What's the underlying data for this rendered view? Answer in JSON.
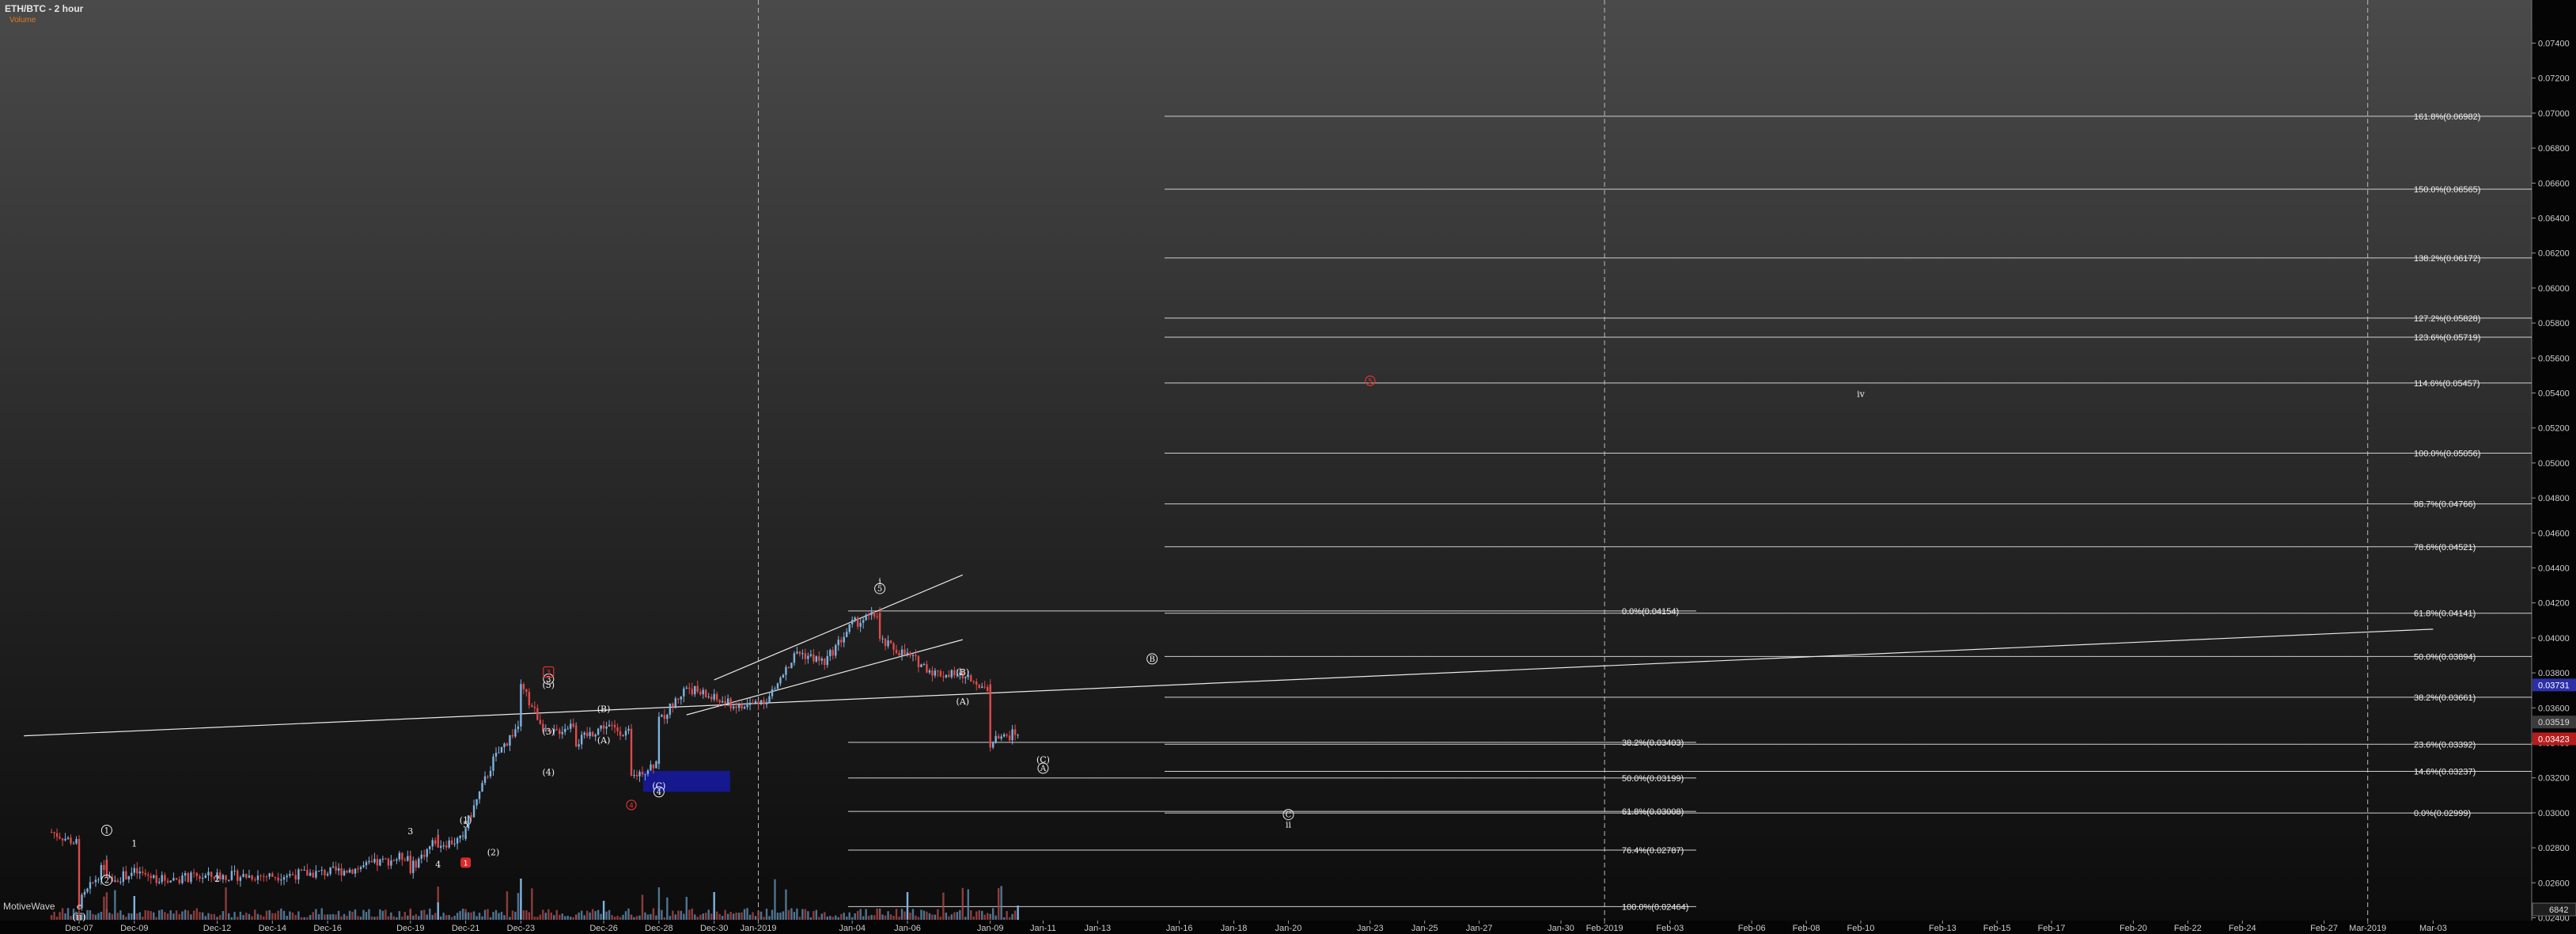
{
  "header": {
    "title": "ETH/BTC - 2 hour",
    "volume_label": "Volume"
  },
  "brand": "MotiveWave",
  "colors": {
    "up": "#7fb2de",
    "down": "#e04a4a",
    "axis_text": "#cccccc",
    "price_current": "#2c2fa5",
    "price_last": "#b71c1c",
    "box": "#16189a",
    "grid": "#d0d0d0"
  },
  "chart_data": {
    "type": "candlestick",
    "title": "ETH/BTC - 2 hour",
    "xlabel": "",
    "ylabel": "",
    "ylim": [
      0.0228,
      0.0742
    ],
    "x_ticks": [
      "Dec-07",
      "Dec-09",
      "Dec-12",
      "Dec-14",
      "Dec-16",
      "Dec-19",
      "Dec-21",
      "Dec-23",
      "Dec-26",
      "Dec-28",
      "Dec-30",
      "Jan-2019",
      "Jan-04",
      "Jan-06",
      "Jan-09",
      "Jan-11",
      "Jan-13",
      "Jan-16",
      "Jan-18",
      "Jan-20",
      "Jan-23",
      "Jan-25",
      "Jan-27",
      "Jan-30",
      "Feb-2019",
      "Feb-03",
      "Feb-06",
      "Feb-08",
      "Feb-10",
      "Feb-13",
      "Feb-15",
      "Feb-17",
      "Feb-20",
      "Feb-22",
      "Feb-24",
      "Feb-27",
      "Mar-2019",
      "Mar-03"
    ],
    "y_ticks": [
      "0.02400",
      "0.02600",
      "0.02800",
      "0.03000",
      "0.03200",
      "0.03400",
      "0.03600",
      "0.03800",
      "0.04000",
      "0.04200",
      "0.04400",
      "0.04600",
      "0.04800",
      "0.05000",
      "0.05200",
      "0.05400",
      "0.05600",
      "0.05800",
      "0.06000",
      "0.06200",
      "0.06400",
      "0.06600",
      "0.06800",
      "0.07000",
      "0.07200",
      "0.07400"
    ],
    "price_labels": {
      "current": "0.03731",
      "last": "0.03423",
      "gray": "0.03519",
      "volume": "6842"
    },
    "price_path": [
      [
        "Dec-06",
        0.0289
      ],
      [
        "Dec-07",
        0.0282
      ],
      [
        "Dec-07",
        0.0248
      ],
      [
        "Dec-08",
        0.0272
      ],
      [
        "Dec-08",
        0.0261
      ],
      [
        "Dec-09",
        0.0266
      ],
      [
        "Dec-10",
        0.0262
      ],
      [
        "Dec-12",
        0.0264
      ],
      [
        "Dec-14",
        0.0264
      ],
      [
        "Dec-16",
        0.0266
      ],
      [
        "Dec-17",
        0.0268
      ],
      [
        "Dec-18",
        0.0272
      ],
      [
        "Dec-19",
        0.0276
      ],
      [
        "Dec-19",
        0.0268
      ],
      [
        "Dec-20",
        0.0286
      ],
      [
        "Dec-20",
        0.0282
      ],
      [
        "Dec-21",
        0.0285
      ],
      [
        "Dec-21",
        0.0292
      ],
      [
        "Dec-22",
        0.033
      ],
      [
        "Dec-23",
        0.0352
      ],
      [
        "Dec-23",
        0.0372
      ],
      [
        "Dec-24",
        0.0344
      ],
      [
        "Dec-25",
        0.0352
      ],
      [
        "Dec-25",
        0.034
      ],
      [
        "Dec-26",
        0.035
      ],
      [
        "Dec-27",
        0.0345
      ],
      [
        "Dec-27",
        0.032
      ],
      [
        "Dec-28",
        0.033
      ],
      [
        "Dec-28",
        0.0352
      ],
      [
        "Dec-29",
        0.0372
      ],
      [
        "Dec-30",
        0.0365
      ],
      [
        "Dec-31",
        0.036
      ],
      [
        "Jan-01",
        0.0366
      ],
      [
        "Jan-02",
        0.0392
      ],
      [
        "Jan-03",
        0.0386
      ],
      [
        "Jan-04",
        0.0408
      ],
      [
        "Jan-05",
        0.0414
      ],
      [
        "Jan-05",
        0.0398
      ],
      [
        "Jan-06",
        0.039
      ],
      [
        "Jan-07",
        0.038
      ],
      [
        "Jan-08",
        0.0378
      ],
      [
        "Jan-09",
        0.0372
      ],
      [
        "Jan-09",
        0.034
      ],
      [
        "Jan-10",
        0.0346
      ],
      [
        "Jan-10",
        0.0351
      ]
    ],
    "trend_lines": [
      {
        "from": [
          "Dec-05",
          0.0344
        ],
        "to": [
          "Mar-03",
          0.0405
        ]
      },
      {
        "from": [
          "Dec-30",
          0.0376
        ],
        "to": [
          "Jan-08",
          0.0436
        ]
      },
      {
        "from": [
          "Dec-29",
          0.0356
        ],
        "to": [
          "Jan-08",
          0.0399
        ]
      }
    ],
    "fib_levels_upper": [
      {
        "label": "161.8%",
        "value": "0.06982"
      },
      {
        "label": "150.0%",
        "value": "0.06565"
      },
      {
        "label": "138.2%",
        "value": "0.06172"
      },
      {
        "label": "127.2%",
        "value": "0.05828"
      },
      {
        "label": "123.6%",
        "value": "0.05719"
      },
      {
        "label": "114.6%",
        "value": "0.05457"
      },
      {
        "label": "100.0%",
        "value": "0.05056"
      },
      {
        "label": "88.7%",
        "value": "0.04766"
      },
      {
        "label": "78.6%",
        "value": "0.04521"
      },
      {
        "label": "61.8%",
        "value": "0.04141"
      },
      {
        "label": "50.0%",
        "value": "0.03894"
      },
      {
        "label": "38.2%",
        "value": "0.03661"
      },
      {
        "label": "23.6%",
        "value": "0.03392"
      },
      {
        "label": "14.6%",
        "value": "0.03237"
      },
      {
        "label": "0.0%",
        "value": "0.02999"
      }
    ],
    "fib_levels_lower": [
      {
        "label": "0.0%",
        "value": "0.04154"
      },
      {
        "label": "38.2%",
        "value": "0.03403"
      },
      {
        "label": "50.0%",
        "value": "0.03199"
      },
      {
        "label": "61.8%",
        "value": "0.03008"
      },
      {
        "label": "76.4%",
        "value": "0.02787"
      },
      {
        "label": "100.0%",
        "value": "0.02464"
      }
    ],
    "wave_labels": [
      {
        "text": "ii",
        "style": "paren",
        "date": "Dec-07",
        "price": 0.02405
      },
      {
        "text": "c",
        "style": "plain",
        "date": "Dec-07",
        "price": 0.02465
      },
      {
        "text": "1",
        "style": "circle",
        "date": "Dec-08",
        "price": 0.029
      },
      {
        "text": "2",
        "style": "circle",
        "date": "Dec-08",
        "price": 0.02615
      },
      {
        "text": "1",
        "style": "plain",
        "date": "Dec-09",
        "price": 0.02825
      },
      {
        "text": "2",
        "style": "plain",
        "date": "Dec-12",
        "price": 0.02625
      },
      {
        "text": "3",
        "style": "plain",
        "date": "Dec-19",
        "price": 0.02895
      },
      {
        "text": "4",
        "style": "plain",
        "date": "Dec-20",
        "price": 0.02705
      },
      {
        "text": "(1)",
        "style": "plain",
        "date": "Dec-21",
        "price": 0.02958
      },
      {
        "text": "5",
        "style": "plain",
        "date": "Dec-21",
        "price": 0.02935
      },
      {
        "text": "(2)",
        "style": "plain",
        "date": "Dec-22",
        "price": 0.02775
      },
      {
        "text": "(3)",
        "style": "plain",
        "date": "Dec-24",
        "price": 0.03465
      },
      {
        "text": "(4)",
        "style": "plain",
        "date": "Dec-24",
        "price": 0.03232
      },
      {
        "text": "3",
        "style": "circle",
        "date": "Dec-24",
        "price": 0.03765
      },
      {
        "text": "(5)",
        "style": "plain",
        "date": "Dec-24",
        "price": 0.03732
      },
      {
        "text": "(B)",
        "style": "plain",
        "date": "Dec-26",
        "price": 0.03595
      },
      {
        "text": "(A)",
        "style": "plain",
        "date": "Dec-26",
        "price": 0.03415
      },
      {
        "text": "(C)",
        "style": "plain",
        "date": "Dec-28",
        "price": 0.03155
      },
      {
        "text": "4",
        "style": "circle",
        "date": "Dec-28",
        "price": 0.0312
      },
      {
        "text": "i",
        "style": "plain",
        "date": "Jan-05",
        "price": 0.04325
      },
      {
        "text": "5",
        "style": "circle",
        "date": "Jan-05",
        "price": 0.04282
      },
      {
        "text": "(B)",
        "style": "plain",
        "date": "Jan-08",
        "price": 0.03805
      },
      {
        "text": "(A)",
        "style": "plain",
        "date": "Jan-08",
        "price": 0.03638
      },
      {
        "text": "B",
        "style": "circle",
        "date": "Jan-15",
        "price": 0.0388
      },
      {
        "text": "(C)",
        "style": "plain",
        "date": "Jan-11",
        "price": 0.03305
      },
      {
        "text": "A",
        "style": "circle",
        "date": "Jan-11",
        "price": 0.03255
      },
      {
        "text": "C",
        "style": "circle",
        "date": "Jan-20",
        "price": 0.0299
      },
      {
        "text": "ii",
        "style": "plain",
        "date": "Jan-20",
        "price": 0.02935
      },
      {
        "text": "iv",
        "style": "plain",
        "date": "Feb-10",
        "price": 0.05395
      }
    ],
    "red_markers": [
      {
        "text": "3",
        "shape": "square",
        "date": "Dec-24",
        "price": 0.03805
      },
      {
        "text": "4",
        "shape": "circle",
        "date": "Dec-27",
        "price": 0.03045
      },
      {
        "text": "5",
        "shape": "circle",
        "date": "Jan-23",
        "price": 0.0547
      },
      {
        "text": "1",
        "shape": "filled",
        "date": "Dec-21",
        "price": 0.02715
      }
    ],
    "demand_box": {
      "from_date": "Dec-27",
      "to_date": "Dec-29",
      "top": 0.0324,
      "bottom": 0.0312
    },
    "vertical_lines": [
      "Jan-2019",
      "Feb-2019",
      "Mar-2019"
    ]
  }
}
